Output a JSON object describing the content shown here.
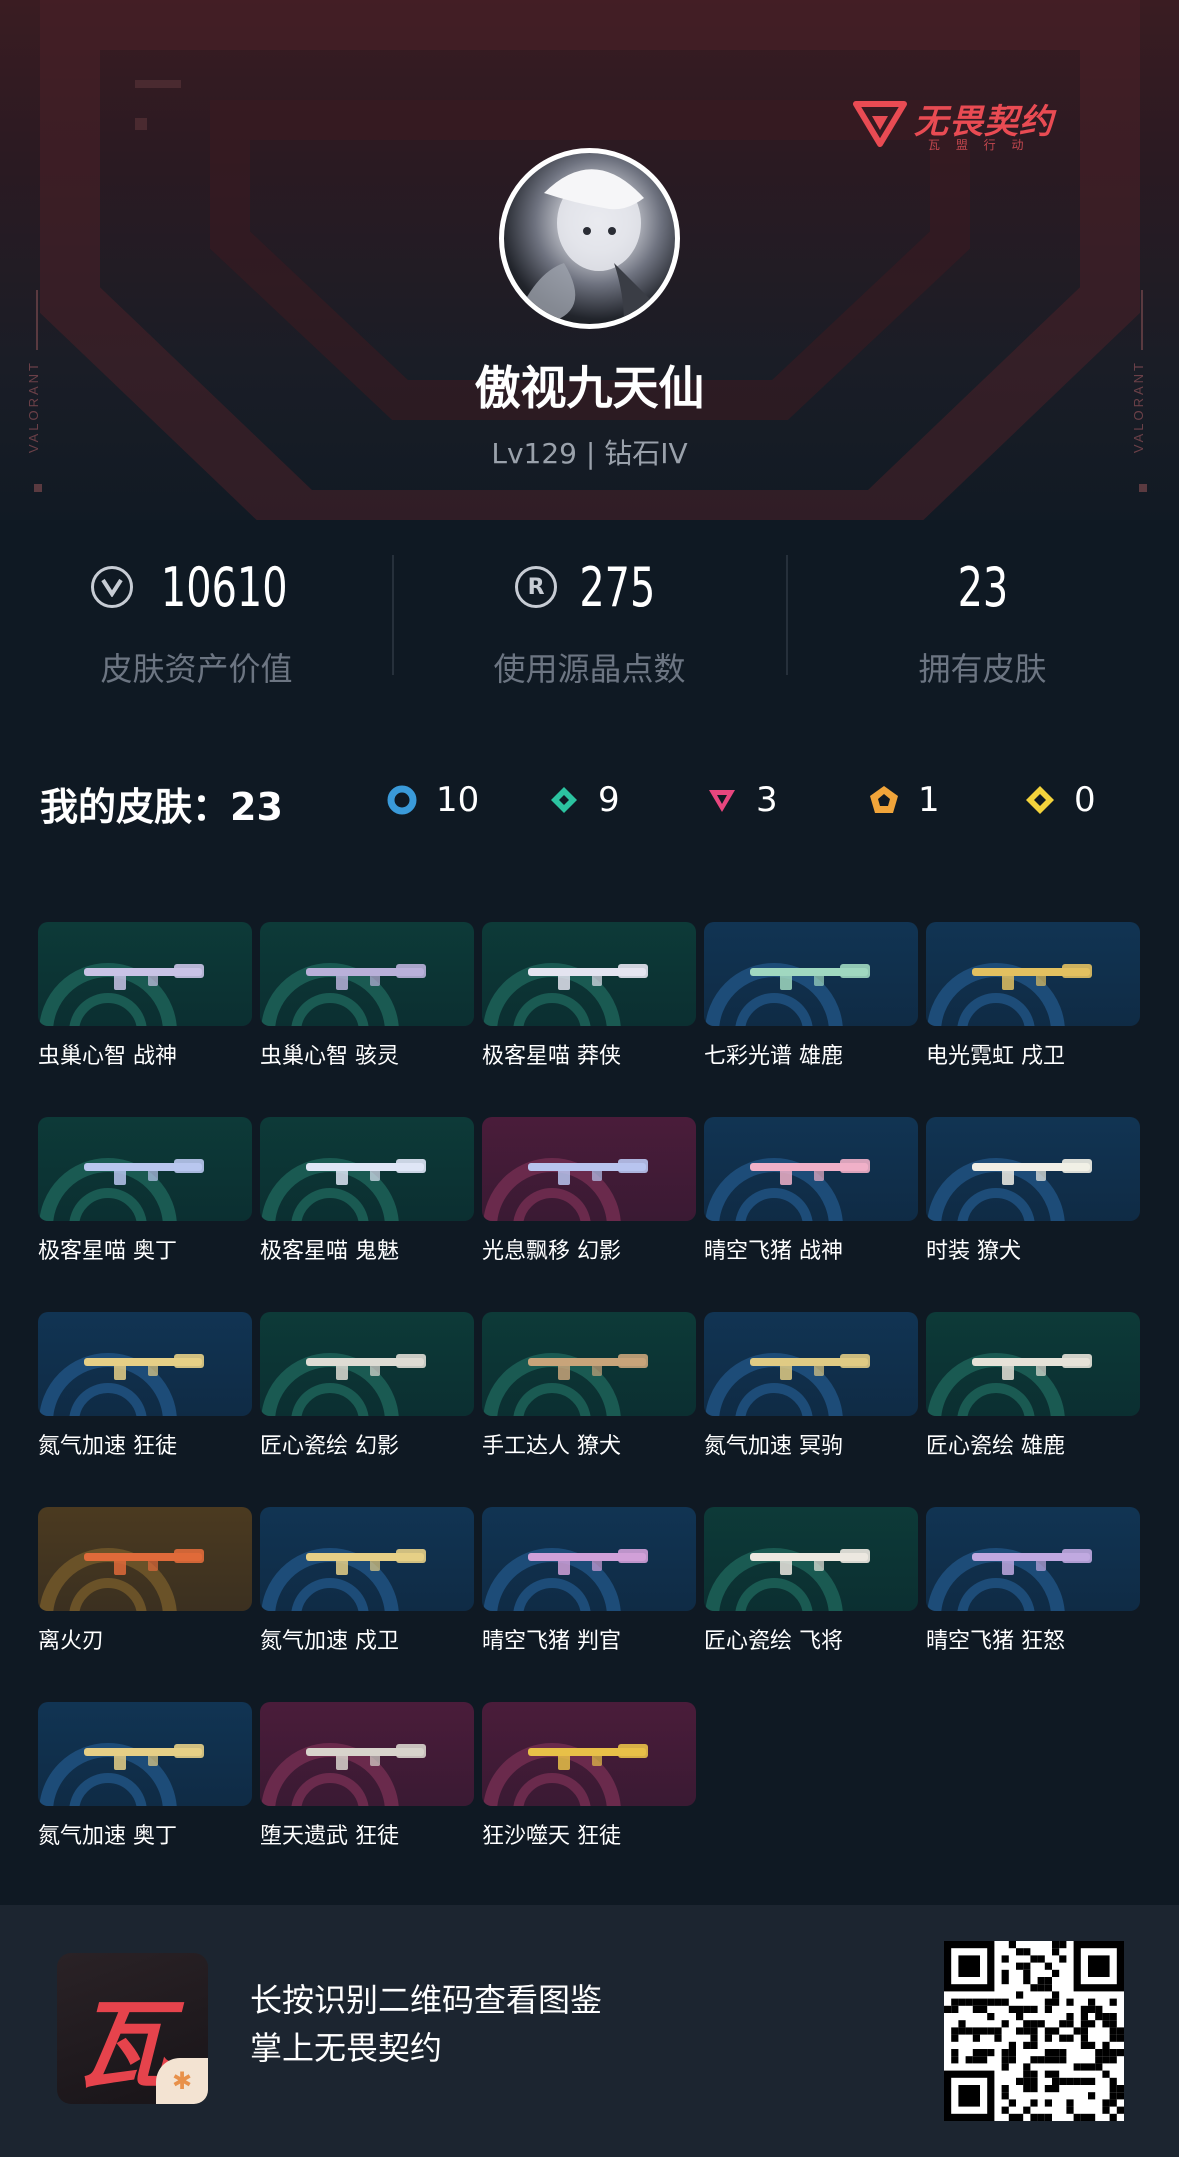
{
  "brand": {
    "name": "无畏契约",
    "sub": "瓦 盟 行 动",
    "side_text": "VALORANT",
    "accent": "#e94b53"
  },
  "profile": {
    "username": "傲视九天仙",
    "level_rank": "Lv129 | 钻石IV"
  },
  "stats": [
    {
      "icon": "valorant-points-icon",
      "value": "10610",
      "label": "皮肤资产价值"
    },
    {
      "icon": "radianite-points-icon",
      "icon_glyph": "R",
      "value": "275",
      "label": "使用源晶点数"
    },
    {
      "value": "23",
      "label": "拥有皮肤"
    }
  ],
  "skins_summary": {
    "title": "我的皮肤：23",
    "tiers": [
      {
        "icon": "select-tier-icon",
        "color": "#3a9ad9",
        "count": "10"
      },
      {
        "icon": "deluxe-tier-icon",
        "color": "#2cc3a0",
        "count": "9"
      },
      {
        "icon": "premium-tier-icon",
        "color": "#e8467e",
        "count": "3"
      },
      {
        "icon": "exclusive-tier-icon",
        "color": "#f0a43a",
        "count": "1"
      },
      {
        "icon": "ultra-tier-icon",
        "color": "#f2d23c",
        "count": "0"
      }
    ]
  },
  "skins": [
    {
      "name": "虫巢心智 战神",
      "tier": "teal"
    },
    {
      "name": "虫巢心智 骇灵",
      "tier": "teal"
    },
    {
      "name": "极客星喵 莽侠",
      "tier": "teal"
    },
    {
      "name": "七彩光谱 雄鹿",
      "tier": "blue"
    },
    {
      "name": "电光霓虹 戌卫",
      "tier": "blue"
    },
    {
      "name": "极客星喵 奥丁",
      "tier": "teal"
    },
    {
      "name": "极客星喵 鬼魅",
      "tier": "teal"
    },
    {
      "name": "光息飘移 幻影",
      "tier": "pink"
    },
    {
      "name": "晴空飞猪 战神",
      "tier": "blue"
    },
    {
      "name": "时装 獠犬",
      "tier": "blue"
    },
    {
      "name": "氮气加速 狂徒",
      "tier": "blue"
    },
    {
      "name": "匠心瓷绘 幻影",
      "tier": "teal"
    },
    {
      "name": "手工达人 獠犬",
      "tier": "teal"
    },
    {
      "name": "氮气加速 冥驹",
      "tier": "blue"
    },
    {
      "name": "匠心瓷绘 雄鹿",
      "tier": "teal"
    },
    {
      "name": "离火刃",
      "tier": "gold"
    },
    {
      "name": "氮气加速 戍卫",
      "tier": "blue"
    },
    {
      "name": "晴空飞猪 判官",
      "tier": "blue"
    },
    {
      "name": "匠心瓷绘 飞将",
      "tier": "teal"
    },
    {
      "name": "晴空飞猪 狂怒",
      "tier": "blue"
    },
    {
      "name": "氮气加速 奥丁",
      "tier": "blue"
    },
    {
      "name": "堕天遗武 狂徒",
      "tier": "pink"
    },
    {
      "name": "狂沙噬天 狂徒",
      "tier": "pink"
    }
  ],
  "footer": {
    "app_icon_glyph": "瓦",
    "line1": "长按识别二维码查看图鉴",
    "line2": "掌上无畏契约",
    "qr_icon": "qr-code-icon"
  }
}
